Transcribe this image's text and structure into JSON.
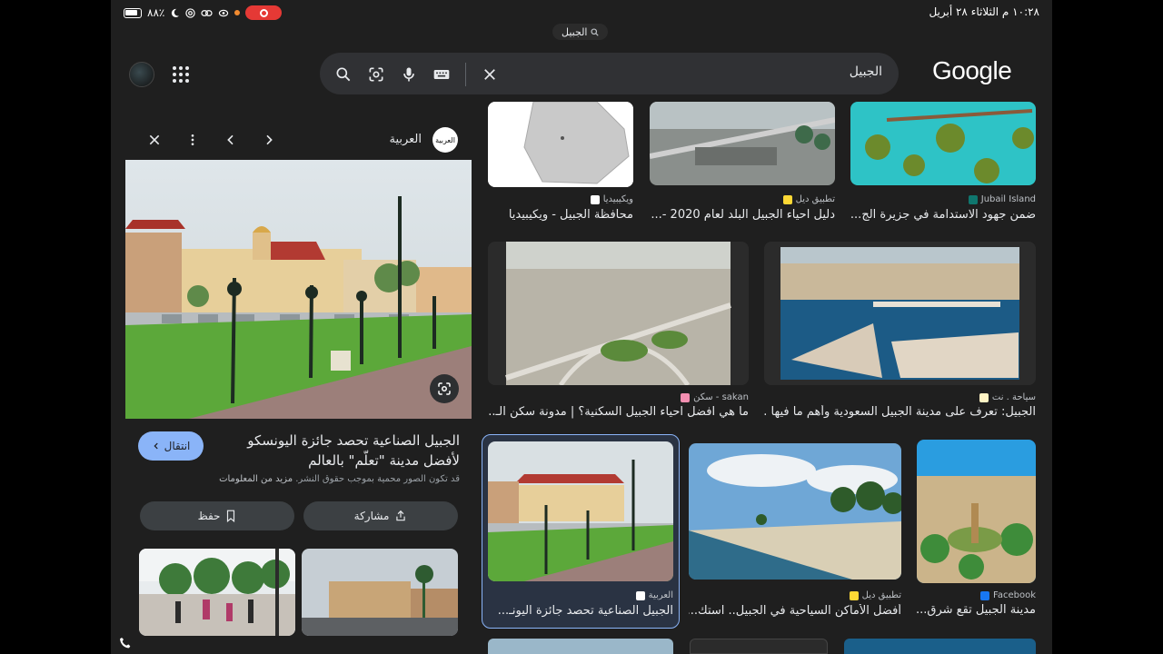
{
  "status_bar": {
    "time_date": "١٠:٢٨ م  الثلاثاء ٢٨ أبريل",
    "battery": "٨٨٪"
  },
  "url_chip": {
    "text": "الجبيل"
  },
  "header": {
    "logo": "Google",
    "search_query": "الجبيل"
  },
  "detail": {
    "source_name": "العربية",
    "source_logo_text": "العربية",
    "title": "الجبيل الصناعية تحصد جائزة اليونسكو لأفضل مدينة \"تعلّم\" بالعالم",
    "visit_label": "انتقال",
    "notice_text": "قد تكون الصور محمية بموجب حقوق النشر.",
    "notice_link": "مزيد من المعلومات",
    "share_label": "مشاركة",
    "save_label": "حفظ"
  },
  "results": [
    {
      "source": "Jubail Island",
      "title": "ضمن جهود الاستدامة في جزيرة الج...",
      "fav_color": "#0f766e"
    },
    {
      "source": "تطبيق ديل",
      "title": "دليل احياء الجبيل البلد لعام 2020 -...",
      "fav_color": "#fdd835"
    },
    {
      "source": "ويكيبيديا",
      "title": "محافظة الجبيل - ويكيبيديا",
      "fav_color": "#ffffff"
    },
    {
      "source": "سياحة . نت",
      "title": "الجبيل: تعرف على مدينة الجبيل السعودية وأهم ما فيها ...",
      "fav_color": "#fff3c4"
    },
    {
      "source": "sakan - سكن",
      "title": "ما هي افضل احياء الجبيل السكنية؟ | مدونة سكن الـ...",
      "fav_color": "#f48fb1"
    },
    {
      "source": "Facebook",
      "title": "مدينة الجبيل تقع شرق...",
      "fav_color": "#1877f2"
    },
    {
      "source": "تطبيق ديل",
      "title": "أفضل الأماكن السياحية في الجبيل.. استك...",
      "fav_color": "#fdd835"
    },
    {
      "source": "العربية",
      "title": "الجبيل الصناعية تحصد جائزة اليونـ...",
      "fav_color": "#ffffff"
    }
  ]
}
